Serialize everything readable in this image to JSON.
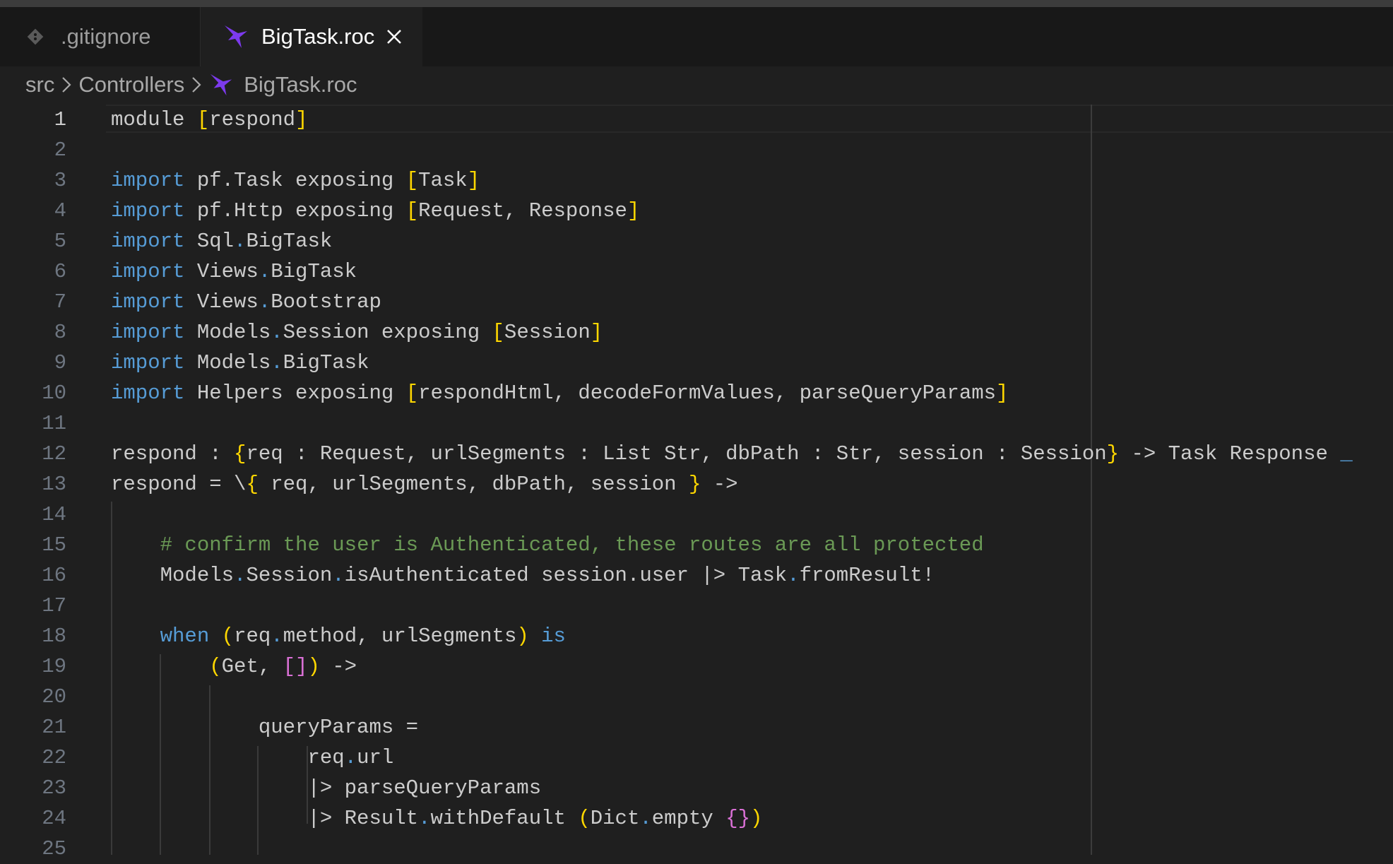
{
  "tabs": [
    {
      "label": ".gitignore",
      "icon": "git-icon",
      "active": false
    },
    {
      "label": "BigTask.roc",
      "icon": "roc-bird-icon",
      "active": true
    }
  ],
  "breadcrumb": {
    "parts": [
      "src",
      "Controllers",
      "BigTask.roc"
    ],
    "separator_icon": "chevron-right-icon",
    "file_icon": "roc-bird-icon"
  },
  "colors": {
    "keyword": "#569cd6",
    "bracket_level1": "#ffd700",
    "bracket_level2": "#da70d6",
    "comment": "#6a9955",
    "text": "#cccccc",
    "background": "#1f1f1f",
    "roc_icon": "#7c3aed"
  },
  "editor": {
    "current_line": 1,
    "lines": [
      {
        "num": "1",
        "text": "module [respond]"
      },
      {
        "num": "2",
        "text": ""
      },
      {
        "num": "3",
        "text": "import pf.Task exposing [Task]"
      },
      {
        "num": "4",
        "text": "import pf.Http exposing [Request, Response]"
      },
      {
        "num": "5",
        "text": "import Sql.BigTask"
      },
      {
        "num": "6",
        "text": "import Views.BigTask"
      },
      {
        "num": "7",
        "text": "import Views.Bootstrap"
      },
      {
        "num": "8",
        "text": "import Models.Session exposing [Session]"
      },
      {
        "num": "9",
        "text": "import Models.BigTask"
      },
      {
        "num": "10",
        "text": "import Helpers exposing [respondHtml, decodeFormValues, parseQueryParams]"
      },
      {
        "num": "11",
        "text": ""
      },
      {
        "num": "12",
        "text": "respond : {req : Request, urlSegments : List Str, dbPath : Str, session : Session} -> Task Response _"
      },
      {
        "num": "13",
        "text": "respond = \\{ req, urlSegments, dbPath, session } ->"
      },
      {
        "num": "14",
        "text": ""
      },
      {
        "num": "15",
        "text": "    # confirm the user is Authenticated, these routes are all protected"
      },
      {
        "num": "16",
        "text": "    Models.Session.isAuthenticated session.user |> Task.fromResult!"
      },
      {
        "num": "17",
        "text": ""
      },
      {
        "num": "18",
        "text": "    when (req.method, urlSegments) is"
      },
      {
        "num": "19",
        "text": "        (Get, []) ->"
      },
      {
        "num": "20",
        "text": ""
      },
      {
        "num": "21",
        "text": "            queryParams ="
      },
      {
        "num": "22",
        "text": "                req.url"
      },
      {
        "num": "23",
        "text": "                |> parseQueryParams"
      },
      {
        "num": "24",
        "text": "                |> Result.withDefault (Dict.empty {})"
      },
      {
        "num": "25",
        "text": ""
      }
    ]
  }
}
